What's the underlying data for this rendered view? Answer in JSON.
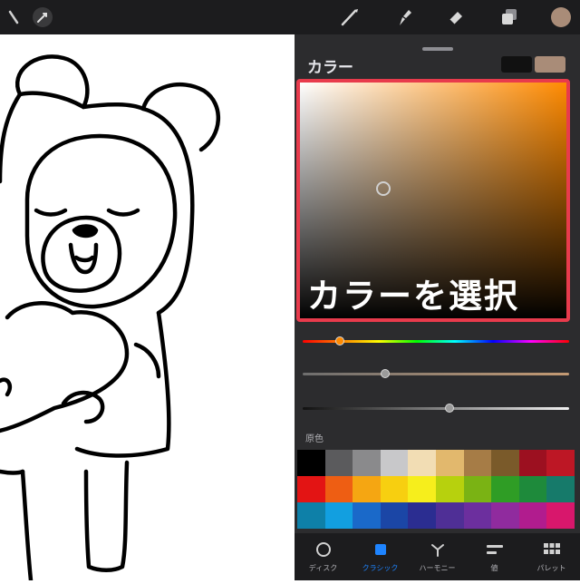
{
  "toolbar": {
    "left_icons": [
      "wrench-icon",
      "magic-wand-icon"
    ],
    "right_icons": [
      "brush-icon",
      "smudge-icon",
      "eraser-icon",
      "layers-icon",
      "color-swatch-icon"
    ],
    "current_color": "#a98c78"
  },
  "panel": {
    "title": "カラー",
    "primary_color": "#111111",
    "secondary_color": "#a98c78",
    "annotation": "カラーを選択",
    "hue": "#ff8a00",
    "highlight_color": "#e83b4c",
    "hue_slider": 0.14,
    "saturation_slider": 0.31,
    "value_slider": 0.55,
    "palette_label": "原色",
    "palette": [
      "#000000",
      "#5b5b5d",
      "#8a8a8c",
      "#c8c8ca",
      "#f2ddb4",
      "#e2b86d",
      "#a67c46",
      "#7a5a2a",
      "#9c1020",
      "#bd1725",
      "#e31414",
      "#ee5e13",
      "#f5a612",
      "#f7cf10",
      "#f6ee1c",
      "#b7d10d",
      "#7ab314",
      "#2f9d25",
      "#1e8a3b",
      "#167a6a",
      "#0e80a8",
      "#129fe0",
      "#1a69c9",
      "#1b46a6",
      "#2b2d91",
      "#4f2f96",
      "#6c2f9e",
      "#902b9e",
      "#b11c8e",
      "#d8176c"
    ]
  },
  "tabs": [
    {
      "label": "ディスク",
      "icon": "circle-icon"
    },
    {
      "label": "クラシック",
      "icon": "square-icon"
    },
    {
      "label": "ハーモニー",
      "icon": "harmony-icon"
    },
    {
      "label": "値",
      "icon": "sliders-icon"
    },
    {
      "label": "パレット",
      "icon": "grid-icon"
    }
  ]
}
